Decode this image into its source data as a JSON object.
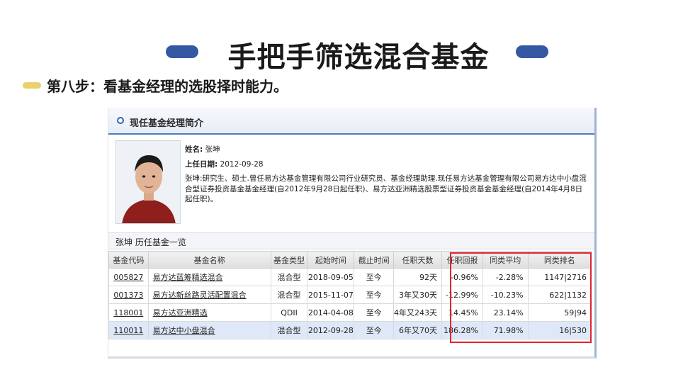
{
  "slide": {
    "title": "手把手筛选混合基金",
    "step_text": "第八步：看基金经理的选股择时能力。"
  },
  "profile": {
    "section_title": "现任基金经理简介",
    "name_label": "姓名:",
    "name": "张坤",
    "date_label": "上任日期:",
    "date": "2012-09-28",
    "bio": "张坤:研究生、硕士.曾任易方达基金管理有限公司行业研究员、基金经理助理.现任易方达基金管理有限公司易方达中小盘混合型证券投资基金基金经理(自2012年9月28日起任职)、易方达亚洲精选股票型证券投资基金基金经理(自2014年4月8日起任职)。"
  },
  "history": {
    "title": "张坤 历任基金一览",
    "columns": [
      "基金代码",
      "基金名称",
      "基金类型",
      "起始时间",
      "截止时间",
      "任职天数",
      "任职回报",
      "同类平均",
      "同类排名"
    ],
    "rows": [
      {
        "code": "005827",
        "name": "易方达蓝筹精选混合",
        "type": "混合型",
        "start": "2018-09-05",
        "end": "至今",
        "days": "92天",
        "ret": "-0.96%",
        "avg": "-2.28%",
        "rank": "1147|2716"
      },
      {
        "code": "001373",
        "name": "易方达新丝路灵活配置混合",
        "type": "混合型",
        "start": "2015-11-07",
        "end": "至今",
        "days": "3年又30天",
        "ret": "-12.99%",
        "avg": "-10.23%",
        "rank": "622|1132"
      },
      {
        "code": "118001",
        "name": "易方达亚洲精选",
        "type": "QDII",
        "start": "2014-04-08",
        "end": "至今",
        "days": "4年又243天",
        "ret": "14.45%",
        "avg": "23.14%",
        "rank": "59|94"
      },
      {
        "code": "110011",
        "name": "易方达中小盘混合",
        "type": "混合型",
        "start": "2012-09-28",
        "end": "至今",
        "days": "6年又70天",
        "ret": "186.28%",
        "avg": "71.98%",
        "rank": "16|530"
      }
    ]
  },
  "colors": {
    "pill": "#3558a3",
    "step_bar": "#e9d16b",
    "positive": "#d3142a",
    "negative": "#149a3c",
    "highlight_box": "#e2252b"
  }
}
